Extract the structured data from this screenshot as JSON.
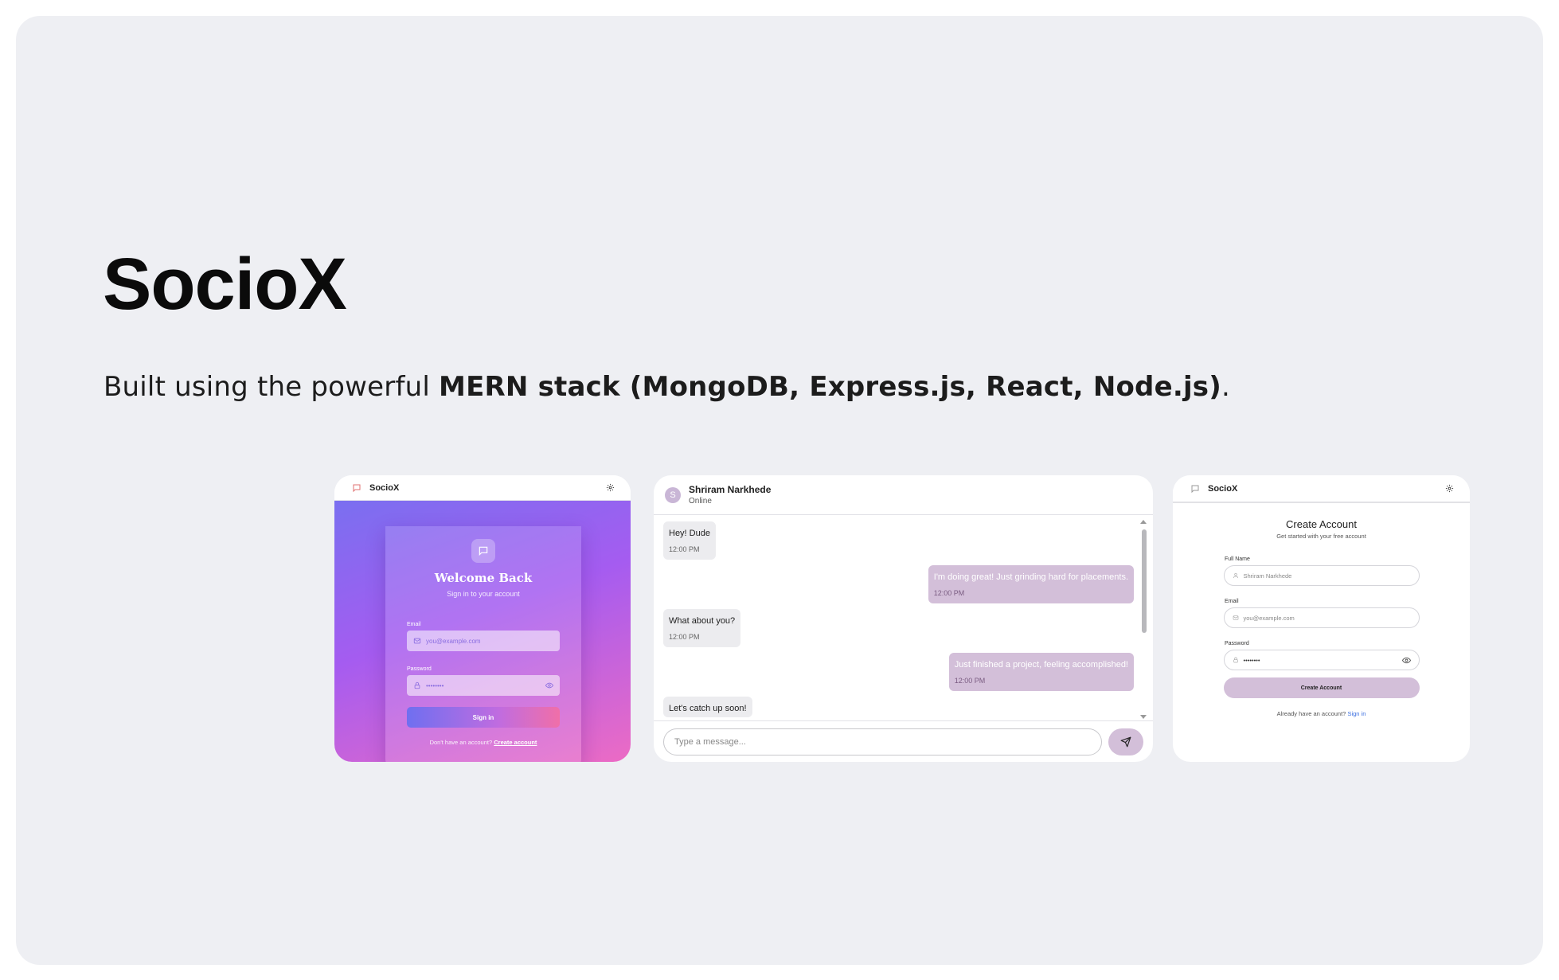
{
  "hero": {
    "title": "SocioX",
    "subtitle_prefix": "Built using the powerful ",
    "subtitle_bold": "MERN stack (MongoDB, Express.js, React, Node.js)",
    "subtitle_suffix": "."
  },
  "login": {
    "brand": "SocioX",
    "title": "Welcome Back",
    "subtitle": "Sign in to your account",
    "email_label": "Email",
    "email_placeholder": "you@example.com",
    "password_label": "Password",
    "password_value": "••••••••",
    "signin_label": "Sign in",
    "footer_text": "Don't have an account?",
    "footer_link": "Create account"
  },
  "chat": {
    "contact_initial": "S",
    "contact_name": "Shriram Narkhede",
    "contact_status": "Online",
    "messages": [
      {
        "text": "Hey! Dude",
        "time": "12:00 PM"
      },
      {
        "text": "I'm doing great! Just grinding hard for placements.",
        "time": "12:00 PM"
      },
      {
        "text": "What about you?",
        "time": "12:00 PM"
      },
      {
        "text": "Just finished a project, feeling accomplished!",
        "time": "12:00 PM"
      },
      {
        "text": "Let's catch up soon!"
      }
    ],
    "input_placeholder": "Type a message..."
  },
  "register": {
    "brand": "SocioX",
    "title": "Create Account",
    "subtitle": "Get started with your free account",
    "name_label": "Full Name",
    "name_placeholder": "Shriram Narkhede",
    "email_label": "Email",
    "email_placeholder": "you@example.com",
    "password_label": "Password",
    "password_value": "••••••••",
    "button_label": "Create Account",
    "footer_text": "Already have an account?",
    "footer_link": "Sign in"
  },
  "colors": {
    "card_bg": "#eeeff3",
    "accent_lilac": "#d3bfd9",
    "gradient_start": "#7a6ff0",
    "gradient_end": "#ec6bc4",
    "link_blue": "#3b6fe0"
  },
  "icons": [
    "chat-bubble-icon",
    "gear-icon",
    "mail-icon",
    "lock-icon",
    "eye-icon",
    "user-icon",
    "send-icon"
  ]
}
